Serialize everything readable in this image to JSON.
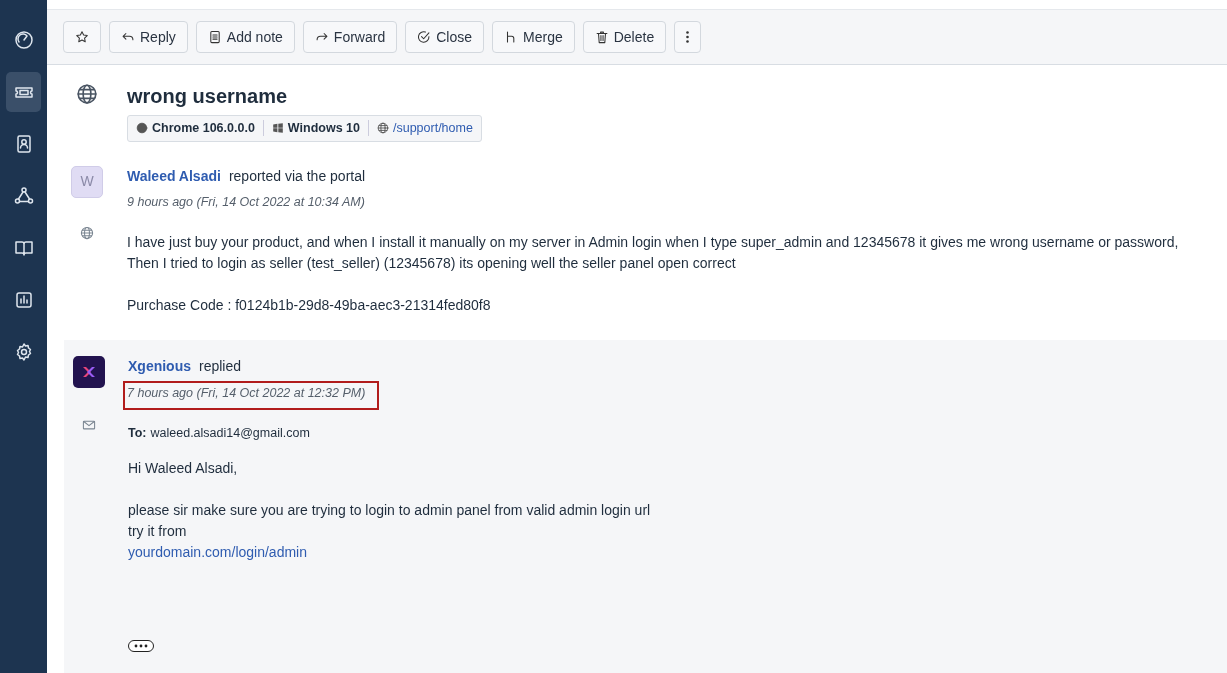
{
  "sidebar": {
    "items": [
      {
        "selected": false
      },
      {
        "selected": true
      },
      {
        "selected": false
      },
      {
        "selected": false
      },
      {
        "selected": false
      },
      {
        "selected": false
      },
      {
        "selected": false
      }
    ]
  },
  "toolbar": {
    "buttons": [
      {
        "label": "Reply"
      },
      {
        "label": "Add note"
      },
      {
        "label": "Forward"
      },
      {
        "label": "Close"
      },
      {
        "label": "Merge"
      },
      {
        "label": "Delete"
      }
    ]
  },
  "ticket": {
    "title": "wrong username",
    "meta": [
      {
        "kind": "browser",
        "text": "Chrome 106.0.0.0"
      },
      {
        "kind": "os",
        "text": "Windows 10"
      },
      {
        "kind": "url",
        "text": "/support/home"
      }
    ]
  },
  "messages": [
    {
      "kind": "customer",
      "avatar_letter": "W",
      "author": "Waleed Alsadi",
      "action": "reported via the portal",
      "time": "9 hours ago (Fri, 14 Oct 2022 at 10:34 AM)",
      "highlighted": false,
      "paragraphs": [
        [
          "I have just buy your product, and when I install it manually on my server in Admin login when I type super_admin and 12345678 it gives me wrong username or password,",
          "Then I tried to login as seller (test_seller) (12345678) its opening well the seller panel open correct"
        ],
        [
          "Purchase Code : f0124b1b-29d8-49ba-aec3-21314fed80f8"
        ]
      ]
    },
    {
      "kind": "agent",
      "author": "Xgenious",
      "action": "replied",
      "time": "7 hours ago (Fri, 14 Oct 2022 at 12:32 PM)",
      "highlighted": true,
      "to_label": "To:",
      "to": "waleed.alsadi14@gmail.com",
      "paragraphs": [
        [
          "Hi Waleed Alsadi,"
        ],
        [
          "please sir make sure you are trying to login to admin panel from valid admin login url",
          "try it from"
        ]
      ],
      "link": "yourdomain.com/login/admin"
    }
  ]
}
